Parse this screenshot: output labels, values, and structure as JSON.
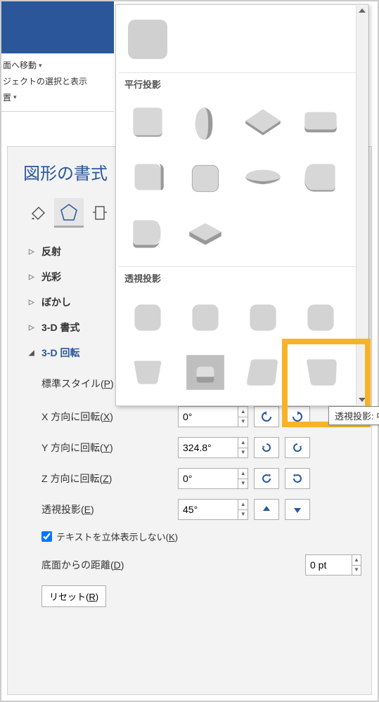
{
  "ribbon": {
    "move_label": "面へ移動",
    "selection_label": "ジェクトの選択と表示",
    "position_label": "置"
  },
  "panel": {
    "title": "図形の書式",
    "sections": {
      "reflection": "反射",
      "glow": "光彩",
      "softedges": "ぼかし",
      "format3d": "3-D 書式",
      "rotation3d": "3-D 回転"
    }
  },
  "rotation": {
    "preset_label": "標準スタイル(",
    "preset_key": "P",
    "x_label": "X 方向に回転(",
    "x_key": "X",
    "x_value": "0°",
    "y_label": "Y 方向に回転(",
    "y_key": "Y",
    "y_value": "324.8°",
    "z_label": "Z 方向に回転(",
    "z_key": "Z",
    "z_value": "0°",
    "persp_label": "透視投影(",
    "persp_key": "E",
    "persp_value": "45°",
    "flat_text_label": "テキストを立体表示しない(",
    "flat_text_key": "K",
    "dist_label": "底面からの距離(",
    "dist_key": "D",
    "dist_value": "0 pt",
    "reset_label": "リセット(",
    "reset_key": "R",
    "close_paren": ")"
  },
  "gallery": {
    "parallel_header": "平行投影",
    "perspective_header": "透視投影"
  },
  "tooltip": "透視投影: 中程度の傾斜"
}
